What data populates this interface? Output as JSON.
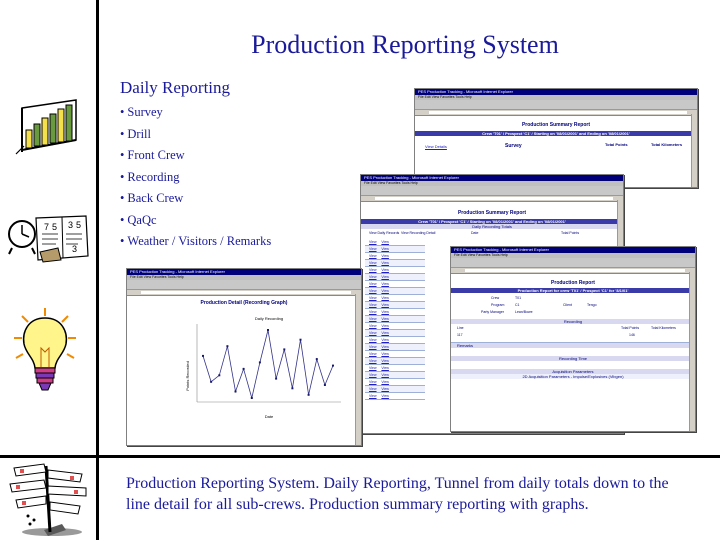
{
  "slide": {
    "title": "Production Reporting System",
    "subtitle": "Daily Reporting",
    "bullets": [
      "Survey",
      "Drill",
      "Front Crew",
      "Recording",
      "Back Crew",
      "QaQc",
      "Weather / Visitors / Remarks"
    ],
    "bullet_char": "•",
    "caption": "Production Reporting System.  Daily Reporting, Tunnel from daily totals down to the line detail for all sub-crews.  Production summary reporting with graphs."
  },
  "icons": [
    "bar-chart-clipart",
    "clock-book-clipart",
    "lightbulb-clipart",
    "signpost-clipart"
  ],
  "screens": {
    "summary_back": {
      "window_title": "PES Production Tracking - Microsoft Internet Explorer",
      "report_title": "Production Summary Report",
      "band": "Crew 'T01' / Prospect 'C1' / Starting on '08/01/2001' and Ending on '08/01/2001'",
      "view_link": "View Details",
      "section": "Survey",
      "col_a": "Total Points",
      "col_b": "Total Kilometers"
    },
    "summary_front": {
      "window_title": "PES Production Tracking - Microsoft Internet Explorer",
      "report_title": "Production Summary Report",
      "band": "Crew 'T01' / Prospect 'C1' / Starting on '08/01/2001' and Ending on '08/01/2001'",
      "section": "Daily Recording Totals",
      "col_a": "View Daily Records",
      "col_b": "View Recording Detail",
      "col_c": "Date",
      "col_d": "Total Points",
      "row_link": "View"
    },
    "graph": {
      "window_title": "PES Production Tracking - Microsoft Internet Explorer",
      "chart_title": "Production Detail (Recording Graph)",
      "series_label": "Daily Recording",
      "xlabel": "Date",
      "ylabel": "Points Recorded",
      "points": [
        22,
        14,
        16,
        25,
        11,
        18,
        9,
        20,
        30,
        15,
        24,
        12,
        27,
        10,
        21,
        13,
        19
      ]
    },
    "detail": {
      "window_title": "PES Production Tracking - Microsoft Internet Explorer",
      "report_title": "Production Report",
      "band": "Production Report for crew 'T01' / Prospect 'C1' for '8/1/01'",
      "crew": "T01",
      "program": "C1",
      "party_manager": "Lean/Bowe",
      "client": "Tengo",
      "line": "117",
      "kilometers": "146",
      "section": "Recording",
      "remarks": "Remarks",
      "recording_time": "Recording Time",
      "acq_params": "Acquisition Parameters",
      "geo_params": "2D Acquisition Parameters - Impulse/Explosives (Vibgen)"
    }
  }
}
